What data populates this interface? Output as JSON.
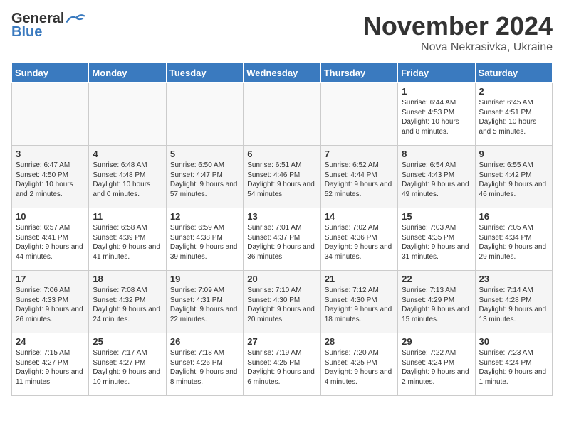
{
  "header": {
    "logo_general": "General",
    "logo_blue": "Blue",
    "month_title": "November 2024",
    "location": "Nova Nekrasivka, Ukraine"
  },
  "weekdays": [
    "Sunday",
    "Monday",
    "Tuesday",
    "Wednesday",
    "Thursday",
    "Friday",
    "Saturday"
  ],
  "weeks": [
    [
      {
        "day": "",
        "info": ""
      },
      {
        "day": "",
        "info": ""
      },
      {
        "day": "",
        "info": ""
      },
      {
        "day": "",
        "info": ""
      },
      {
        "day": "",
        "info": ""
      },
      {
        "day": "1",
        "info": "Sunrise: 6:44 AM\nSunset: 4:53 PM\nDaylight: 10 hours and 8 minutes."
      },
      {
        "day": "2",
        "info": "Sunrise: 6:45 AM\nSunset: 4:51 PM\nDaylight: 10 hours and 5 minutes."
      }
    ],
    [
      {
        "day": "3",
        "info": "Sunrise: 6:47 AM\nSunset: 4:50 PM\nDaylight: 10 hours and 2 minutes."
      },
      {
        "day": "4",
        "info": "Sunrise: 6:48 AM\nSunset: 4:48 PM\nDaylight: 10 hours and 0 minutes."
      },
      {
        "day": "5",
        "info": "Sunrise: 6:50 AM\nSunset: 4:47 PM\nDaylight: 9 hours and 57 minutes."
      },
      {
        "day": "6",
        "info": "Sunrise: 6:51 AM\nSunset: 4:46 PM\nDaylight: 9 hours and 54 minutes."
      },
      {
        "day": "7",
        "info": "Sunrise: 6:52 AM\nSunset: 4:44 PM\nDaylight: 9 hours and 52 minutes."
      },
      {
        "day": "8",
        "info": "Sunrise: 6:54 AM\nSunset: 4:43 PM\nDaylight: 9 hours and 49 minutes."
      },
      {
        "day": "9",
        "info": "Sunrise: 6:55 AM\nSunset: 4:42 PM\nDaylight: 9 hours and 46 minutes."
      }
    ],
    [
      {
        "day": "10",
        "info": "Sunrise: 6:57 AM\nSunset: 4:41 PM\nDaylight: 9 hours and 44 minutes."
      },
      {
        "day": "11",
        "info": "Sunrise: 6:58 AM\nSunset: 4:39 PM\nDaylight: 9 hours and 41 minutes."
      },
      {
        "day": "12",
        "info": "Sunrise: 6:59 AM\nSunset: 4:38 PM\nDaylight: 9 hours and 39 minutes."
      },
      {
        "day": "13",
        "info": "Sunrise: 7:01 AM\nSunset: 4:37 PM\nDaylight: 9 hours and 36 minutes."
      },
      {
        "day": "14",
        "info": "Sunrise: 7:02 AM\nSunset: 4:36 PM\nDaylight: 9 hours and 34 minutes."
      },
      {
        "day": "15",
        "info": "Sunrise: 7:03 AM\nSunset: 4:35 PM\nDaylight: 9 hours and 31 minutes."
      },
      {
        "day": "16",
        "info": "Sunrise: 7:05 AM\nSunset: 4:34 PM\nDaylight: 9 hours and 29 minutes."
      }
    ],
    [
      {
        "day": "17",
        "info": "Sunrise: 7:06 AM\nSunset: 4:33 PM\nDaylight: 9 hours and 26 minutes."
      },
      {
        "day": "18",
        "info": "Sunrise: 7:08 AM\nSunset: 4:32 PM\nDaylight: 9 hours and 24 minutes."
      },
      {
        "day": "19",
        "info": "Sunrise: 7:09 AM\nSunset: 4:31 PM\nDaylight: 9 hours and 22 minutes."
      },
      {
        "day": "20",
        "info": "Sunrise: 7:10 AM\nSunset: 4:30 PM\nDaylight: 9 hours and 20 minutes."
      },
      {
        "day": "21",
        "info": "Sunrise: 7:12 AM\nSunset: 4:30 PM\nDaylight: 9 hours and 18 minutes."
      },
      {
        "day": "22",
        "info": "Sunrise: 7:13 AM\nSunset: 4:29 PM\nDaylight: 9 hours and 15 minutes."
      },
      {
        "day": "23",
        "info": "Sunrise: 7:14 AM\nSunset: 4:28 PM\nDaylight: 9 hours and 13 minutes."
      }
    ],
    [
      {
        "day": "24",
        "info": "Sunrise: 7:15 AM\nSunset: 4:27 PM\nDaylight: 9 hours and 11 minutes."
      },
      {
        "day": "25",
        "info": "Sunrise: 7:17 AM\nSunset: 4:27 PM\nDaylight: 9 hours and 10 minutes."
      },
      {
        "day": "26",
        "info": "Sunrise: 7:18 AM\nSunset: 4:26 PM\nDaylight: 9 hours and 8 minutes."
      },
      {
        "day": "27",
        "info": "Sunrise: 7:19 AM\nSunset: 4:25 PM\nDaylight: 9 hours and 6 minutes."
      },
      {
        "day": "28",
        "info": "Sunrise: 7:20 AM\nSunset: 4:25 PM\nDaylight: 9 hours and 4 minutes."
      },
      {
        "day": "29",
        "info": "Sunrise: 7:22 AM\nSunset: 4:24 PM\nDaylight: 9 hours and 2 minutes."
      },
      {
        "day": "30",
        "info": "Sunrise: 7:23 AM\nSunset: 4:24 PM\nDaylight: 9 hours and 1 minute."
      }
    ]
  ]
}
